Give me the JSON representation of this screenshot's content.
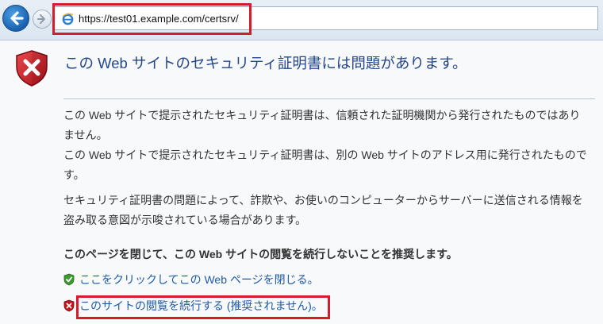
{
  "toolbar": {
    "address_url": "https://test01.example.com/certsrv/",
    "back_icon": "back-arrow-icon",
    "forward_icon": "forward-arrow-icon",
    "browser_icon": "ie-logo-icon"
  },
  "content": {
    "title": "この Web サイトのセキュリティ証明書には問題があります。",
    "paragraphs": [
      "この Web サイトで提示されたセキュリティ証明書は、信頼された証明機関から発行されたものではありません。",
      "この Web サイトで提示されたセキュリティ証明書は、別の Web サイトのアドレス用に発行されたものです。",
      "セキュリティ証明書の問題によって、詐欺や、お使いのコンピューターからサーバーに送信される情報を盗み取る意図が示唆されている場合があります。"
    ],
    "recommendation": "このページを閉じて、この Web サイトの閲覧を続行しないことを推奨します。",
    "close_link": "ここをクリックしてこの Web ページを閉じる。",
    "continue_link": "このサイトの閲覧を続行する (推奨されません)。"
  },
  "colors": {
    "title": "#26478a",
    "link": "#1e5aa6",
    "highlight_box": "#d41c2c",
    "shield_red": "#c4161c",
    "check_green": "#3a9a2c"
  }
}
